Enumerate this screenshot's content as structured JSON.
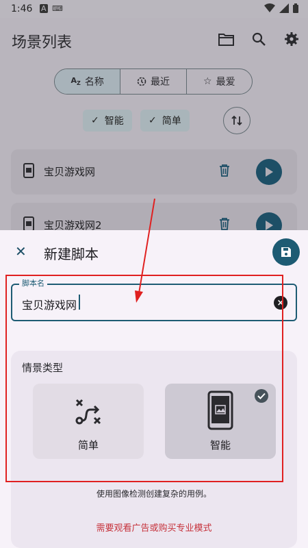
{
  "status_bar": {
    "time": "1:46",
    "notif_a": "A",
    "notif_kbd": "⌨"
  },
  "header": {
    "title": "场景列表"
  },
  "sort_tabs": [
    {
      "label": "名称",
      "icon": "az-sort-icon",
      "selected": true
    },
    {
      "label": "最近",
      "icon": "clock-icon",
      "selected": false
    },
    {
      "label": "最爱",
      "icon": "star-icon",
      "selected": false
    }
  ],
  "filters": [
    {
      "label": "智能",
      "checked": true
    },
    {
      "label": "简单",
      "checked": true
    }
  ],
  "scenes": [
    {
      "name": "宝贝游戏网"
    },
    {
      "name": "宝贝游戏网2"
    }
  ],
  "dialog": {
    "title": "新建脚本",
    "name_field": {
      "label": "脚本名",
      "value": "宝贝游戏网"
    },
    "type_section": {
      "title": "情景类型",
      "options": [
        {
          "label": "简单",
          "icon": "route-icon",
          "selected": false
        },
        {
          "label": "智能",
          "icon": "phone-image-icon",
          "selected": true
        }
      ],
      "description": "使用图像检测创建复杂的用例。",
      "promo": "需要观看广告或购买专业模式"
    }
  },
  "colors": {
    "accent": "#1d5b73",
    "promo": "#c6323b",
    "annotation": "#e02020"
  }
}
